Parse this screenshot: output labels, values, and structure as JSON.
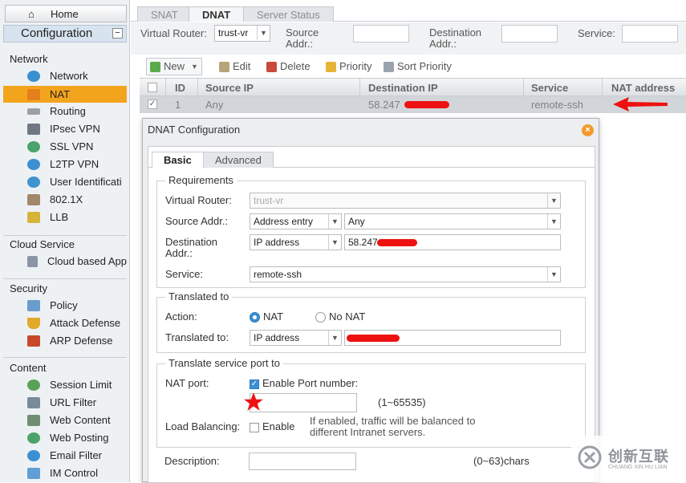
{
  "sidebar": {
    "home": "Home",
    "configuration": "Configuration",
    "minimize": "−",
    "sections": [
      {
        "title": "Network",
        "items": [
          "Network",
          "NAT",
          "Routing",
          "IPsec VPN",
          "SSL VPN",
          "L2TP VPN",
          "User Identificati",
          "802.1X",
          "LLB"
        ]
      },
      {
        "title": "Cloud Service",
        "items": [
          "Cloud based App"
        ]
      },
      {
        "title": "Security",
        "items": [
          "Policy",
          "Attack Defense",
          "ARP Defense"
        ]
      },
      {
        "title": "Content",
        "items": [
          "Session Limit",
          "URL Filter",
          "Web Content",
          "Web Posting",
          "Email Filter",
          "IM Control"
        ]
      }
    ],
    "active_item": "NAT"
  },
  "tabs": [
    "SNAT",
    "DNAT",
    "Server Status"
  ],
  "active_tab": "DNAT",
  "filter": {
    "virtual_router_label": "Virtual Router:",
    "virtual_router_value": "trust-vr",
    "source_label": "Source\nAddr.:",
    "dest_label": "Destination\nAddr.:",
    "service_label": "Service:"
  },
  "toolbar": {
    "new": "New",
    "edit": "Edit",
    "delete": "Delete",
    "priority": "Priority",
    "sort_priority": "Sort Priority"
  },
  "grid": {
    "columns": [
      "ID",
      "Source IP",
      "Destination IP",
      "Service",
      "NAT address"
    ],
    "rows": [
      {
        "id": "1",
        "source": "Any",
        "destination": "58.247",
        "service": "remote-ssh"
      }
    ]
  },
  "dialog": {
    "title": "DNAT Configuration",
    "close": "×",
    "tabs": [
      "Basic",
      "Advanced"
    ],
    "requirements": {
      "title": "Requirements",
      "virtual_router_label": "Virtual Router:",
      "virtual_router_value": "trust-vr",
      "source_label": "Source Addr.:",
      "source_type": "Address entry",
      "source_value": "Any",
      "dest_label": "Destination\nAddr.:",
      "dest_type": "IP address",
      "dest_value": "58.247",
      "service_label": "Service:",
      "service_value": "remote-ssh"
    },
    "translated": {
      "title": "Translated to",
      "action_label": "Action:",
      "nat": "NAT",
      "no_nat": "No NAT",
      "translated_label": "Translated to:",
      "translated_type": "IP address"
    },
    "port": {
      "title": "Translate service port to",
      "nat_port_label": "NAT port:",
      "enable_port": "Enable Port number:",
      "range": "(1~65535)",
      "lb_label": "Load Balancing:",
      "lb_enable": "Enable",
      "lb_note": "If enabled, traffic will be balanced to\ndifferent Intranet servers."
    },
    "description_label": "Description:",
    "description_range": "(0~63)chars"
  },
  "watermark": {
    "cn": "创新互联",
    "en": "CHUANG XIN HU LIAN"
  },
  "colors": {
    "accent": "#f3a41d",
    "radio": "#3b8fd4",
    "redaction": "#e11111"
  }
}
